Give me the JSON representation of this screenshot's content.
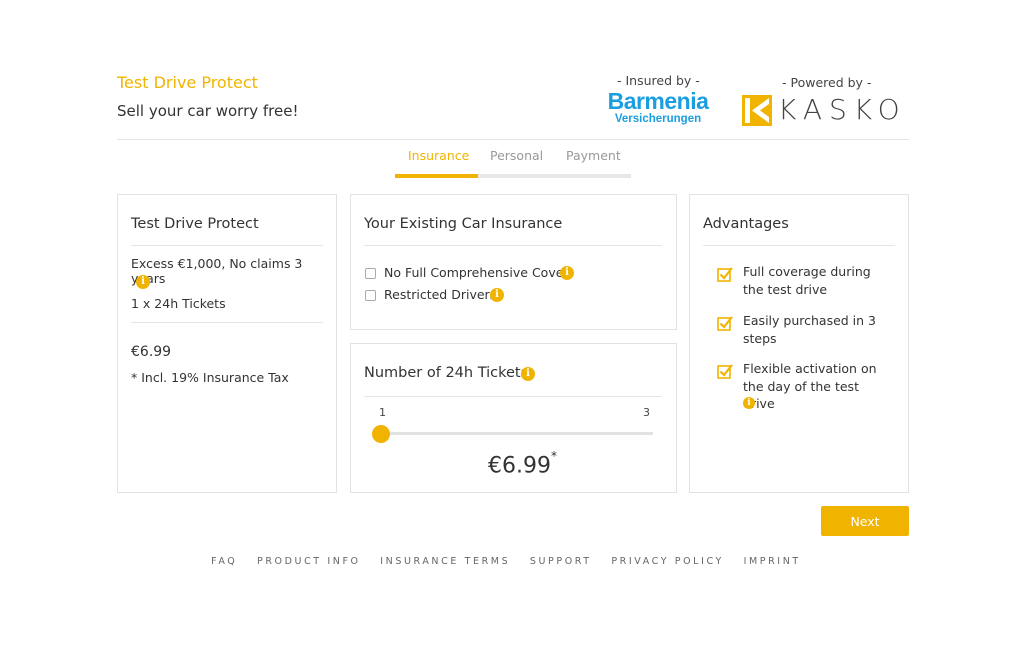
{
  "header": {
    "title": "Test Drive Protect",
    "subtitle": "Sell your car worry free!",
    "insured_by_label": "- Insured by -",
    "insurer_name": "Barmenia",
    "insurer_subname": "Versicherungen",
    "powered_by_label": "- Powered by -",
    "powered_by_name": "KASKO"
  },
  "tabs": [
    {
      "label": "Insurance",
      "active": true
    },
    {
      "label": "Personal",
      "active": false
    },
    {
      "label": "Payment",
      "active": false
    }
  ],
  "summary": {
    "title": "Test Drive Protect",
    "excess_text": "Excess €1,000, No claims 3 years",
    "tickets_text": "1 x 24h Tickets",
    "price": "€6.99",
    "tax_note": "* Incl. 19% Insurance Tax"
  },
  "existing_insurance": {
    "title": "Your Existing Car Insurance",
    "options": [
      {
        "label": "No Full Comprehensive Cover",
        "checked": false
      },
      {
        "label": "Restricted Drivers",
        "checked": false
      }
    ]
  },
  "tickets": {
    "title": "Number of 24h Tickets",
    "min_label": "1",
    "max_label": "3",
    "value": 1,
    "price": "€6.99",
    "price_marker": "*"
  },
  "advantages": {
    "title": "Advantages",
    "items": [
      {
        "text": "Full coverage during the test drive"
      },
      {
        "text": "Easily purchased in 3 steps"
      },
      {
        "text": "Flexible activation on the day of the test drive"
      }
    ]
  },
  "actions": {
    "next_label": "Next"
  },
  "footer": {
    "links": [
      "FAQ",
      "PRODUCT INFO",
      "INSURANCE TERMS",
      "SUPPORT",
      "PRIVACY POLICY",
      "IMPRINT"
    ]
  },
  "colors": {
    "accent": "#f0b400",
    "insurer_blue": "#1a9ee0",
    "border": "#e2e2e2"
  },
  "icons": {
    "info": "info-icon",
    "check": "checkbox-checked-icon"
  }
}
